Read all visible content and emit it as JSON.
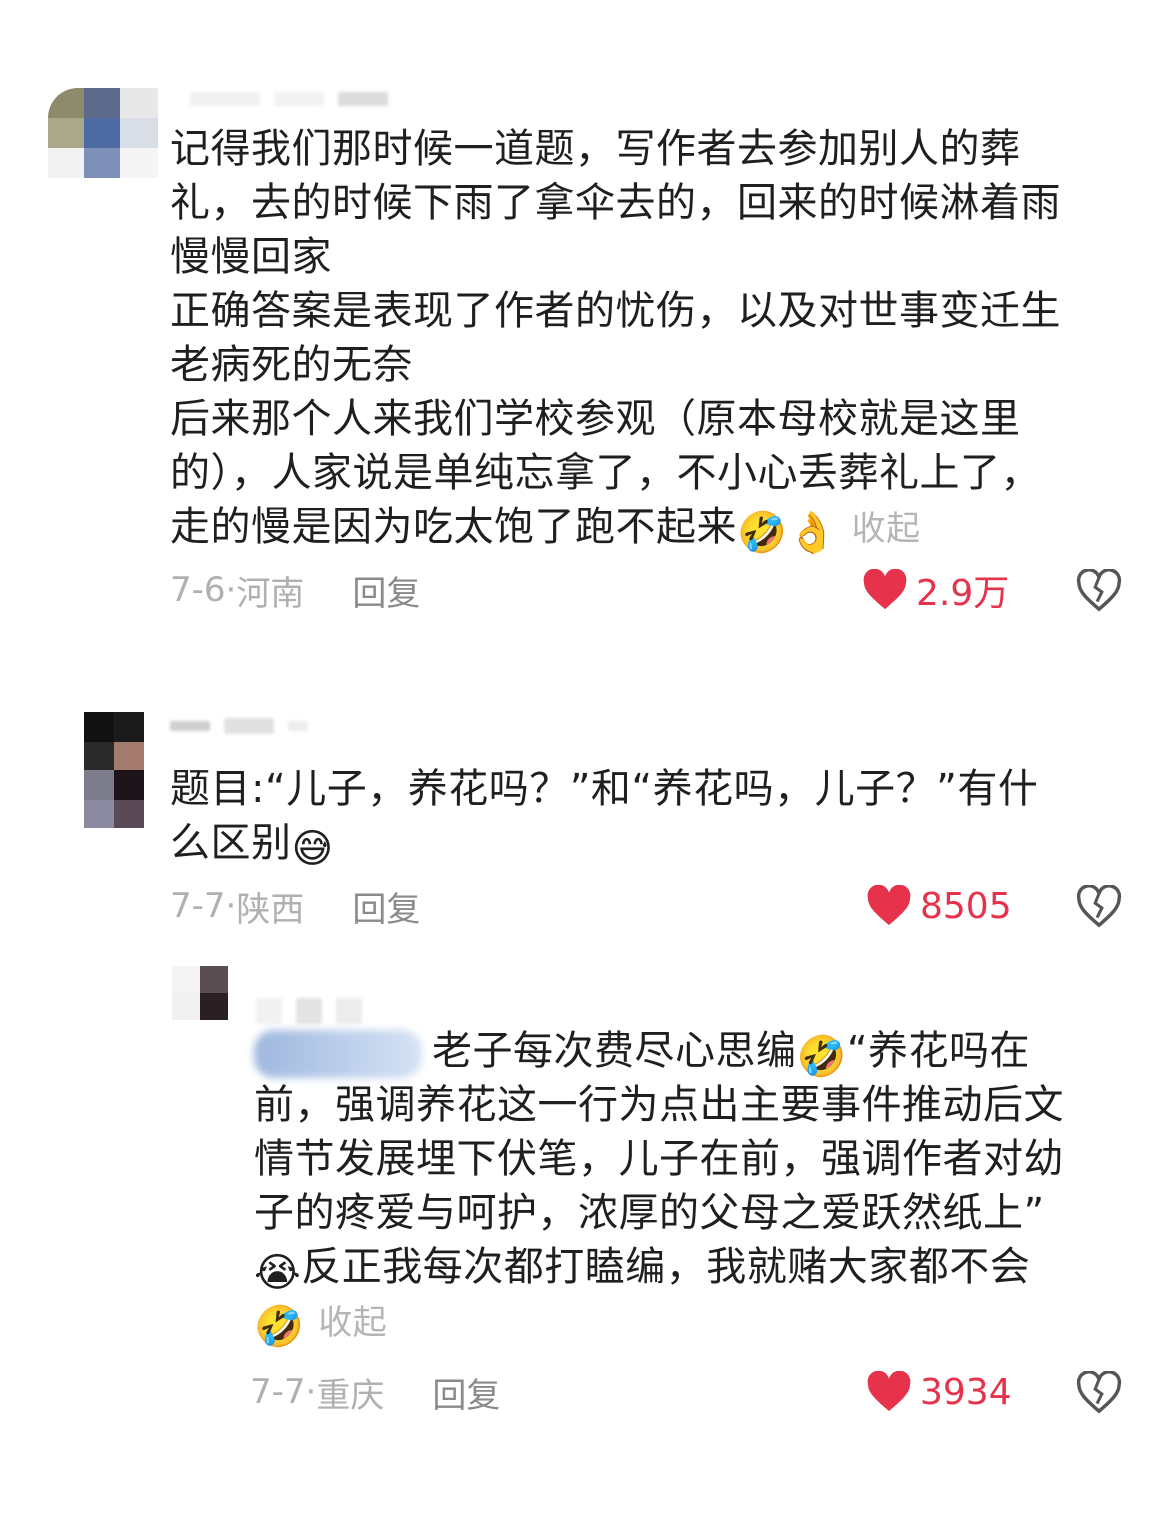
{
  "comments": [
    {
      "lines": [
        "记得我们那时候一道题，写作者去参加别人的葬",
        "礼，去的时候下雨了拿伞去的，回来的时候淋着雨",
        "慢慢回家",
        "正确答案是表现了作者的忧伤，以及对世事变迁生",
        "老病死的无奈",
        "后来那个人来我们学校参观（原本母校就是这里",
        "的），人家说是单纯忘拿了，不小心丢葬礼上了，",
        "走的慢是因为吃太饱了跑不起来"
      ],
      "emojis": [
        "🤣",
        "👌"
      ],
      "collapse": "收起",
      "date": "7-6·",
      "location": "河南",
      "reply": "回复",
      "likes": "2.9万"
    },
    {
      "lines": [
        "题目:“儿子，养花吗？”和“养花吗，儿子？”有什",
        "么区别"
      ],
      "emojis": [
        "😅"
      ],
      "date": "7-7·",
      "location": "陕西",
      "reply": "回复",
      "likes": "8505"
    },
    {
      "lines_head": "老子每次费尽心思编",
      "lines_head_after": "“养花吗在",
      "lines": [
        "前，强调养花这一行为点出主要事件推动后文",
        "情节发展埋下伏笔，儿子在前，强调作者对幼",
        "子的疼爱与呵护，浓厚的父母之爱跃然纸上”"
      ],
      "line_last": "反正我每次都打瞌编，我就赌大家都不会",
      "emojis": [
        "🤣",
        "😭",
        "🤣"
      ],
      "collapse": "收起",
      "date": "7-7·",
      "location": "重庆",
      "reply": "回复",
      "likes": "3934"
    }
  ],
  "colors": {
    "like_red": "#e6334b",
    "meta_gray": "#b0b0b0",
    "text": "#1f1f1f"
  },
  "icons": [
    "heart-icon",
    "broken-heart-icon"
  ]
}
